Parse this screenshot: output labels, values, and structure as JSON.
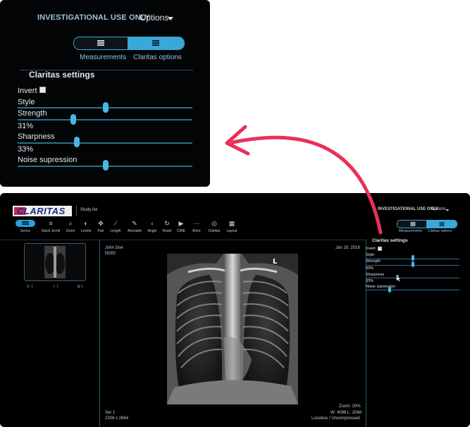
{
  "zoom_panel": {
    "header": {
      "notice": "INVESTIGATIONAL USE ONLY",
      "options_label": "Options"
    },
    "tabs": [
      {
        "label": "Measurements",
        "active": false
      },
      {
        "label": "Claritas options",
        "active": true
      }
    ],
    "settings": {
      "title": "Claritas settings",
      "invert_label": "Invert",
      "invert_checked": false,
      "style_label": "Style",
      "strength_label": "Strength",
      "strength_value": "31%",
      "sharpness_label": "Sharpness",
      "sharpness_value": "33%",
      "noise_label": "Noise supression"
    }
  },
  "app": {
    "logo_text": "CLARITAS",
    "study_list": "Study list",
    "header": {
      "notice": "INVESTIGATIONAL USE ONLY",
      "options_label": "Options"
    },
    "toolbar": [
      {
        "label": "Series",
        "icon": "grid-icon"
      },
      {
        "label": "Stack Scroll",
        "icon": "stack-scroll-icon"
      },
      {
        "label": "Zoom",
        "icon": "search-icon"
      },
      {
        "label": "Levels",
        "icon": "levels-icon"
      },
      {
        "label": "Pan",
        "icon": "pan-icon"
      },
      {
        "label": "Length",
        "icon": "ruler-icon"
      },
      {
        "label": "Annotate",
        "icon": "annotate-icon"
      },
      {
        "label": "Angle",
        "icon": "angle-icon"
      },
      {
        "label": "Reset",
        "icon": "reset-icon"
      },
      {
        "label": "CINE",
        "icon": "cine-icon"
      },
      {
        "label": "More",
        "icon": "more-icon"
      },
      {
        "label": "Claritas",
        "icon": "claritas-icon"
      },
      {
        "label": "Layout",
        "icon": "layout-icon"
      }
    ],
    "tabs": [
      {
        "label": "Measurements",
        "active": false
      },
      {
        "label": "Claritas options",
        "active": true
      }
    ],
    "thumbnail_info": {
      "series_number": "1",
      "instance_number": "1",
      "image_count": "1"
    },
    "viewer": {
      "patient_name": "John Doe",
      "patient_id": "NOID",
      "study_date": "Jan 19, 2018",
      "series": "Ser 1",
      "dimensions": "2208 x 2664",
      "zoom": "Zoom: 20%",
      "window_level": "W: 4096 L: 2048",
      "compression": "Lossless / Uncompressed"
    },
    "settings": {
      "title": "Claritas settings",
      "invert_label": "Invert",
      "style_label": "Style",
      "strength_label": "Strength",
      "strength_value": "50%",
      "sharpness_label": "Sharpness",
      "sharpness_value": "33%",
      "noise_label": "Noise supression"
    }
  },
  "colors": {
    "accent": "#3aa8d8",
    "arrow": "#e8305a",
    "background": "#000000"
  }
}
